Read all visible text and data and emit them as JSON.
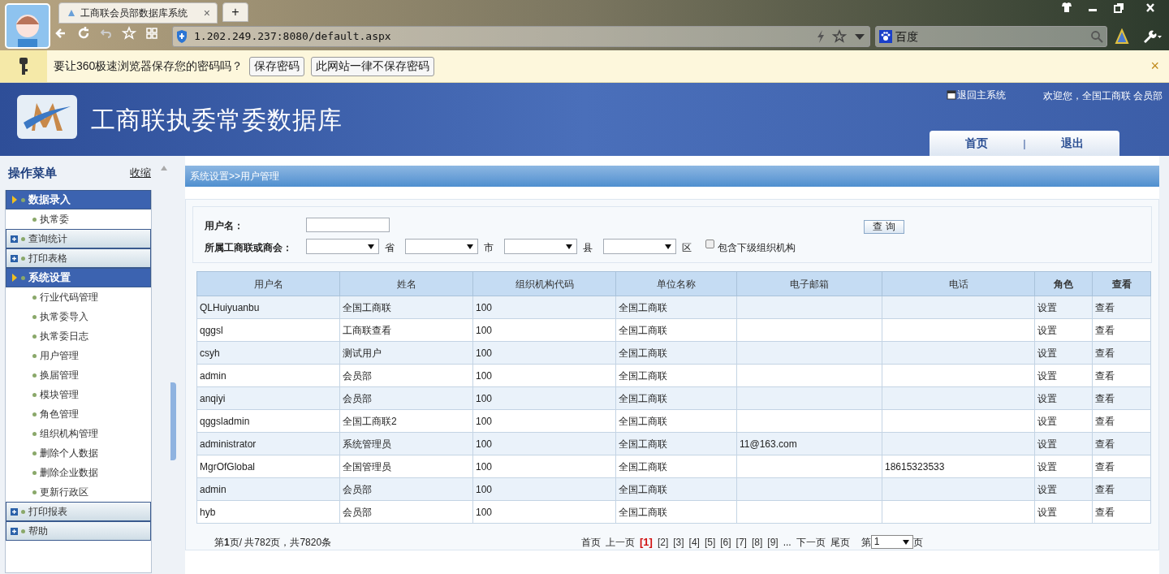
{
  "browser": {
    "tab_title": "工商联会员部数据库系统",
    "tab_close": "×",
    "new_tab": "+",
    "url": "1.202.249.237:8080/default.aspx",
    "search_engine": "百度"
  },
  "password_bar": {
    "message": "要让360极速浏览器保存您的密码吗？",
    "buttons": [
      "保存密码",
      "此网站一律不保存密码"
    ],
    "close": "×"
  },
  "header": {
    "title": "工商联执委常委数据库",
    "back_link": "退回主系统",
    "welcome": "欢迎您，全国工商联 会员部",
    "nav": [
      {
        "label": "首页"
      },
      {
        "label": "退出"
      }
    ],
    "nav_separator": "|"
  },
  "sidebar": {
    "title": "操作菜单",
    "collapse": "收缩",
    "groups": [
      {
        "label": "数据录入",
        "expanded": true,
        "children": [
          "执常委"
        ]
      },
      {
        "label": "查询统计",
        "expanded": false
      },
      {
        "label": "打印表格",
        "expanded": false
      },
      {
        "label": "系统设置",
        "expanded": true,
        "children": [
          "行业代码管理",
          "执常委导入",
          "执常委日志",
          "用户管理",
          "换届管理",
          "模块管理",
          "角色管理",
          "组织机构管理",
          "删除个人数据",
          "删除企业数据",
          "更新行政区"
        ]
      },
      {
        "label": "打印报表",
        "expanded": false
      },
      {
        "label": "帮助",
        "expanded": false
      }
    ]
  },
  "breadcrumb": "系统设置>>用户管理",
  "search_form": {
    "username_label": "用户名：",
    "org_label": "所属工商联或商会：",
    "region_units": [
      "省",
      "市",
      "县",
      "区"
    ],
    "include_sub": {
      "label": "包含下级组织机构",
      "checked": false
    },
    "query_button": "查 询"
  },
  "table": {
    "columns": [
      "用户名",
      "姓名",
      "组织机构代码",
      "单位名称",
      "电子邮箱",
      "电话",
      "角色",
      "查看"
    ],
    "rows": [
      [
        "QLHuiyuanbu",
        "全国工商联",
        "100",
        "全国工商联",
        "",
        "",
        "设置",
        "查看"
      ],
      [
        "qggsl",
        "工商联查看",
        "100",
        "全国工商联",
        "",
        "",
        "设置",
        "查看"
      ],
      [
        "csyh",
        "测试用户",
        "100",
        "全国工商联",
        "",
        "",
        "设置",
        "查看"
      ],
      [
        "admin",
        "会员部",
        "100",
        "全国工商联",
        "",
        "",
        "设置",
        "查看"
      ],
      [
        "anqiyi",
        "会员部",
        "100",
        "全国工商联",
        "",
        "",
        "设置",
        "查看"
      ],
      [
        "qggsladmin",
        "全国工商联2",
        "100",
        "全国工商联",
        "",
        "",
        "设置",
        "查看"
      ],
      [
        "administrator",
        "系统管理员",
        "100",
        "全国工商联",
        "11@163.com",
        "",
        "设置",
        "查看"
      ],
      [
        "MgrOfGlobal",
        "全国管理员",
        "100",
        "全国工商联",
        "",
        "18615323533",
        "设置",
        "查看"
      ],
      [
        "admin",
        "会员部",
        "100",
        "全国工商联",
        "",
        "",
        "设置",
        "查看"
      ],
      [
        "hyb",
        "会员部",
        "100",
        "全国工商联",
        "",
        "",
        "设置",
        "查看"
      ]
    ]
  },
  "pagination": {
    "summary": "第**1**页/ 共782页，共7820条",
    "first": "首页",
    "prev": "上一页",
    "pages": [
      {
        "label": "[1]",
        "selected": true
      },
      {
        "label": "[2]",
        "selected": false
      },
      {
        "label": "[3]",
        "selected": false
      },
      {
        "label": "[4]",
        "selected": false
      },
      {
        "label": "[5]",
        "selected": false
      },
      {
        "label": "[6]",
        "selected": false
      },
      {
        "label": "[7]",
        "selected": false
      },
      {
        "label": "[8]",
        "selected": false
      },
      {
        "label": "[9]",
        "selected": false
      }
    ],
    "ellipsis": "...",
    "next": "下一页",
    "last": "尾页",
    "goto_prefix": "第",
    "goto_value": "1",
    "goto_suffix": "页"
  }
}
